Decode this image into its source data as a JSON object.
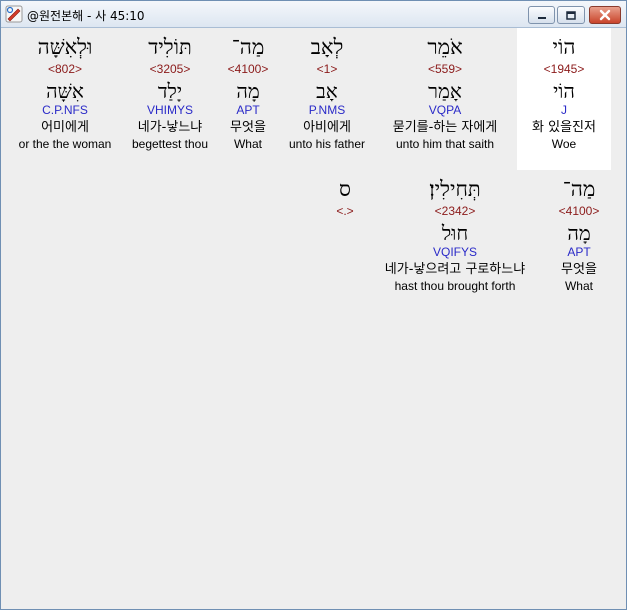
{
  "window": {
    "title": "@원전본해 - 사 45:10",
    "icon": "bible-app-icon",
    "buttons": [
      "minimize-icon",
      "maximize-icon",
      "close-icon"
    ]
  },
  "colors": {
    "strong": "#8b1a1a",
    "morph": "#2a2ac8",
    "highlight": "#ffffff",
    "background": "#eeeeee"
  },
  "words": [
    {
      "heb": "הוֹי",
      "strong": "<1945>",
      "lemma": "הוֹי",
      "morph": "J",
      "kor": "화 있을진저",
      "eng": "Woe"
    },
    {
      "heb": "אֹמֵר",
      "strong": "<559>",
      "lemma": "אָמַר",
      "morph": "VQPA",
      "kor": "묻기를-하는 자에게",
      "eng": "unto him that saith"
    },
    {
      "heb": "לְאָב",
      "strong": "<1>",
      "lemma": "אָב",
      "morph": "P.NMS",
      "kor": "아비에게",
      "eng": "unto his father"
    },
    {
      "heb": "מַה־",
      "strong": "<4100>",
      "lemma": "מָה",
      "morph": "APT",
      "kor": "무엇을",
      "eng": "What"
    },
    {
      "heb": "תּוֹלִיד",
      "strong": "<3205>",
      "lemma": "יָלַד",
      "morph": "VHIMYS",
      "kor": "네가-낳느냐",
      "eng": "begettest thou"
    },
    {
      "heb": "וּלְאִשָּׁה",
      "strong": "<802>",
      "lemma": "אִשָּׁה",
      "morph": "C.P.NFS",
      "kor": "어미에게",
      "eng": "or the the woman"
    },
    {
      "heb": "מַה־",
      "strong": "<4100>",
      "lemma": "מָה",
      "morph": "APT",
      "kor": "무엇을",
      "eng": "What"
    },
    {
      "heb": "תְּחִילִין׃",
      "strong": "<2342>",
      "lemma": "חוּל",
      "morph": "VQIFYS",
      "kor": "네가-낳으려고 구로하느냐",
      "eng": "hast thou brought forth"
    },
    {
      "heb": "ס",
      "strong": "<.>",
      "lemma": "",
      "morph": "",
      "kor": "",
      "eng": ""
    }
  ]
}
